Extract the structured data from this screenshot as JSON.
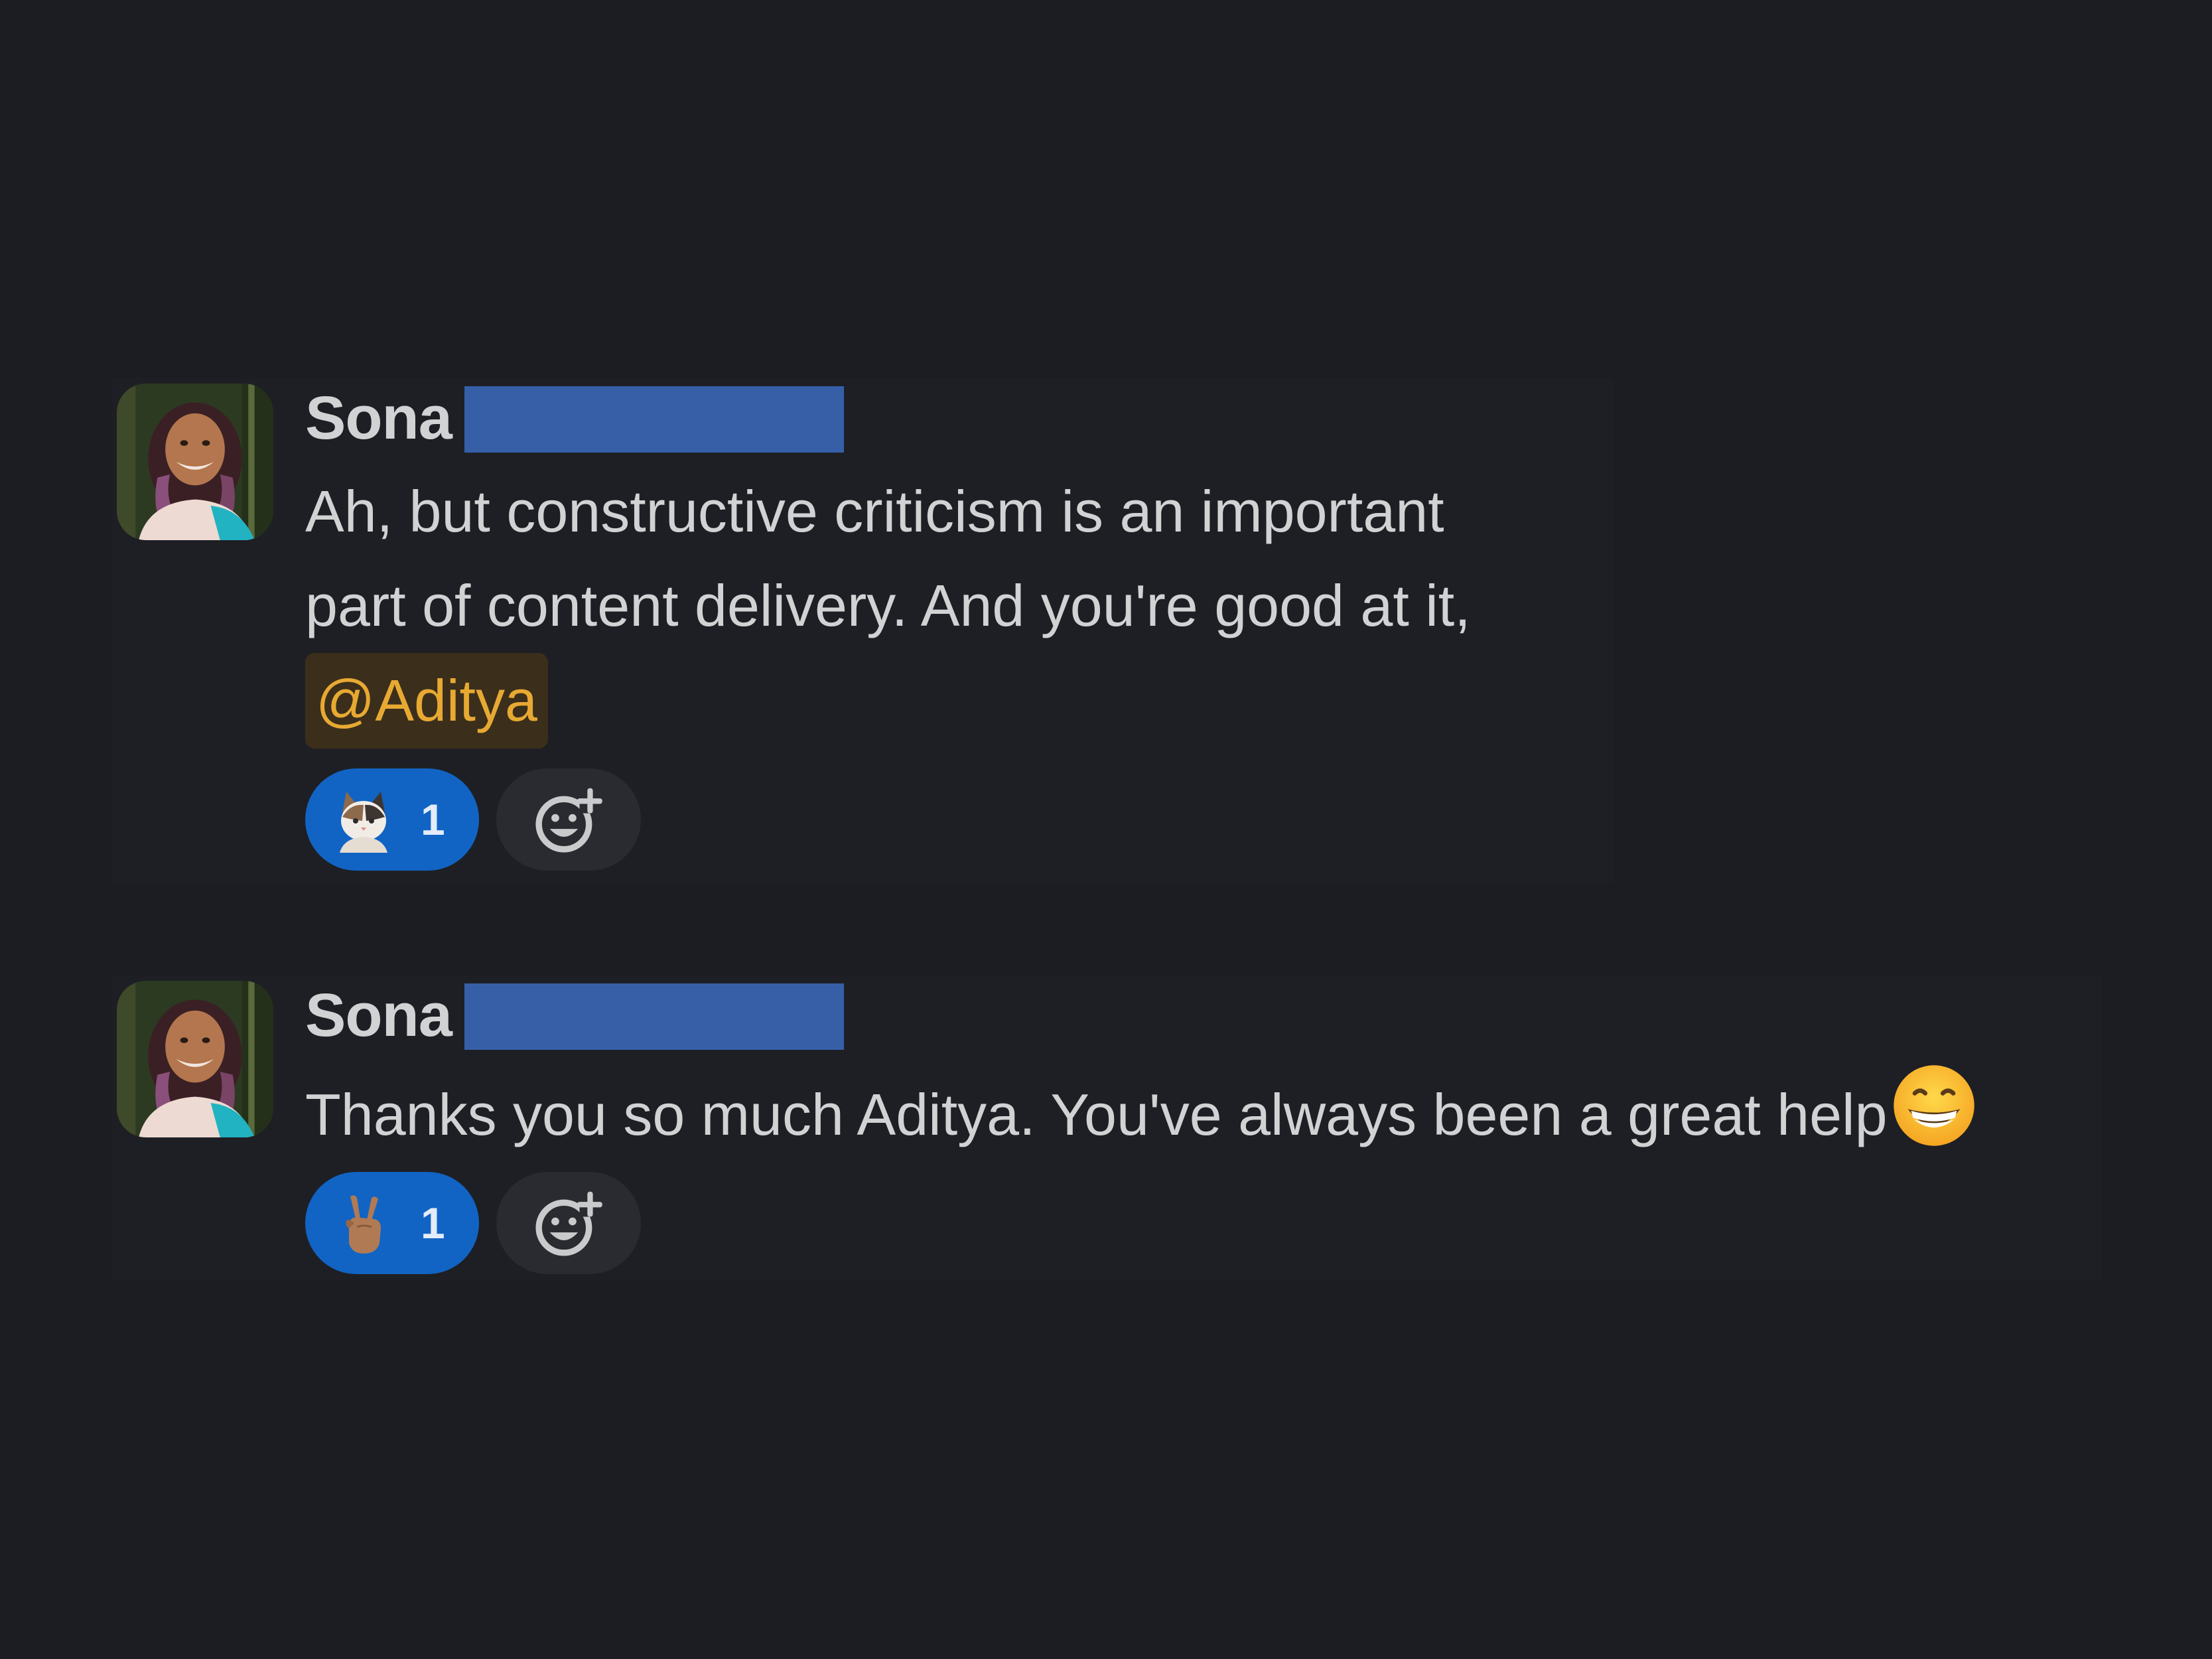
{
  "messages": [
    {
      "author": "Sona",
      "lines": [
        "Ah, but constructive criticism is an important",
        "part of content delivery. And you're good at it,"
      ],
      "mention": "@Aditya",
      "reaction": {
        "emoji": "cat-face",
        "count": "1"
      }
    },
    {
      "author": "Sona",
      "text": "Thanks you so much Aditya. You've always been a great help",
      "trailing_emoji": "grinning-face",
      "reaction": {
        "emoji": "victory-hand",
        "count": "1"
      }
    }
  ],
  "colors": {
    "background": "#1c1d22",
    "redaction": "#365fa8",
    "reaction_pill": "#1164c4",
    "mention_text": "#e8a933",
    "mention_bg": "#3b2f1b"
  }
}
